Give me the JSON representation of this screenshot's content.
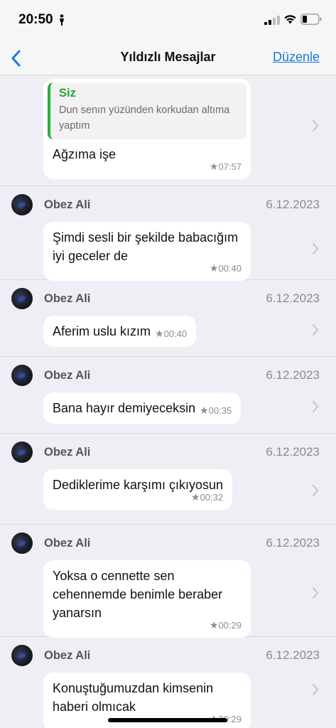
{
  "status": {
    "time": "20:50"
  },
  "nav": {
    "back_label": "",
    "title": "Yıldızlı Mesajlar",
    "edit_label": "Düzenle"
  },
  "messages": [
    {
      "quote_author": "Siz",
      "quote_text": "Dun senın yüzünden korkudan altıma yaptım",
      "text": "Ağzıma işe",
      "time": "07:57"
    },
    {
      "sender": "Obez Ali",
      "date": "6.12.2023",
      "text": "Şimdi sesli bir şekilde babacığım iyi geceler de",
      "time": "00:40"
    },
    {
      "sender": "Obez Ali",
      "date": "6.12.2023",
      "text": "Aferim uslu kızım",
      "time": "00:40"
    },
    {
      "sender": "Obez Ali",
      "date": "6.12.2023",
      "text": "Bana hayır demiyeceksin",
      "time": "00:35"
    },
    {
      "sender": "Obez Ali",
      "date": "6.12.2023",
      "text": "Dediklerime karşımı çıkıyosun",
      "time": "00:32"
    },
    {
      "sender": "Obez Ali",
      "date": "6.12.2023",
      "text": "Yoksa o cennette sen cehennemde benimle beraber yanarsın",
      "time": "00:29"
    },
    {
      "sender": "Obez Ali",
      "date": "6.12.2023",
      "text": "Konuştuğumuzdan kimsenin haberi olmıcak",
      "time": "00:29"
    }
  ],
  "icons": {
    "back": "chevron-left-icon",
    "chevron": "chevron-right-icon",
    "star": "star-icon",
    "accent": "#1b7ad6",
    "quote_accent": "#25b03a"
  }
}
